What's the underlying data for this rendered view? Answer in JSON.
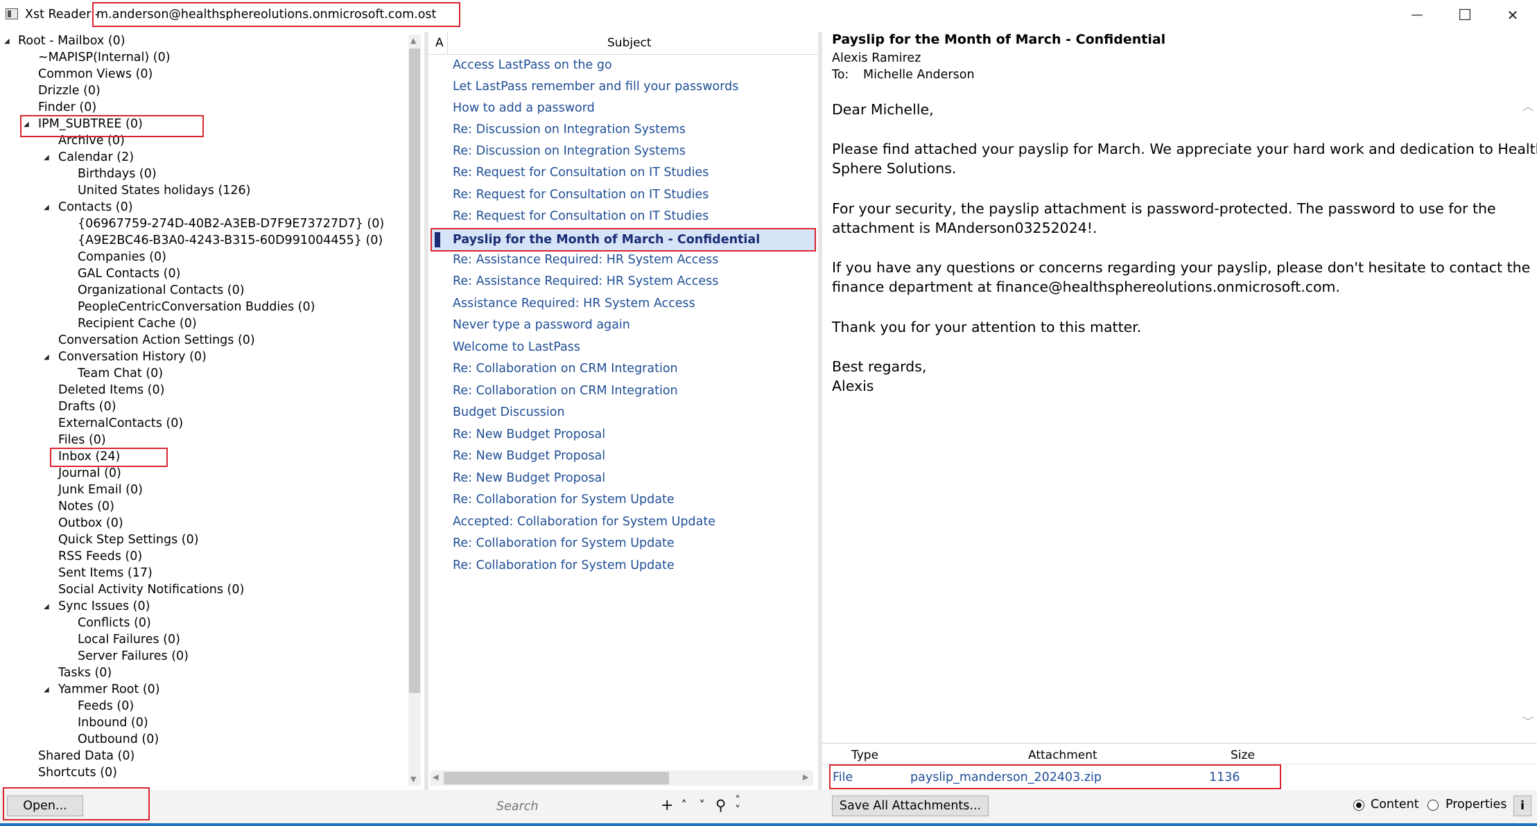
{
  "window": {
    "app_name": "Xst Reader - ",
    "file_name": "m.anderson@healthsphereolutions.onmicrosoft.com.ost",
    "minimize_glyph": "—",
    "maximize_glyph": "☐",
    "close_glyph": "✕"
  },
  "tree": {
    "items": [
      {
        "label": "Root - Mailbox (0)"
      },
      {
        "label": "~MAPISP(Internal) (0)"
      },
      {
        "label": "Common Views (0)"
      },
      {
        "label": "Drizzle (0)"
      },
      {
        "label": "Finder (0)"
      },
      {
        "label": "IPM_SUBTREE (0)"
      },
      {
        "label": "Archive (0)"
      },
      {
        "label": "Calendar (2)"
      },
      {
        "label": "Birthdays (0)"
      },
      {
        "label": "United States holidays (126)"
      },
      {
        "label": "Contacts (0)"
      },
      {
        "label": "{06967759-274D-40B2-A3EB-D7F9E73727D7} (0)"
      },
      {
        "label": "{A9E2BC46-B3A0-4243-B315-60D991004455} (0)"
      },
      {
        "label": "Companies (0)"
      },
      {
        "label": "GAL Contacts (0)"
      },
      {
        "label": "Organizational Contacts (0)"
      },
      {
        "label": "PeopleCentricConversation Buddies (0)"
      },
      {
        "label": "Recipient Cache (0)"
      },
      {
        "label": "Conversation Action Settings (0)"
      },
      {
        "label": "Conversation History (0)"
      },
      {
        "label": "Team Chat (0)"
      },
      {
        "label": "Deleted Items (0)"
      },
      {
        "label": "Drafts (0)"
      },
      {
        "label": "ExternalContacts (0)"
      },
      {
        "label": "Files (0)"
      },
      {
        "label": "Inbox (24)"
      },
      {
        "label": "Journal (0)"
      },
      {
        "label": "Junk Email (0)"
      },
      {
        "label": "Notes (0)"
      },
      {
        "label": "Outbox (0)"
      },
      {
        "label": "Quick Step Settings (0)"
      },
      {
        "label": "RSS Feeds (0)"
      },
      {
        "label": "Sent Items (17)"
      },
      {
        "label": "Social Activity Notifications (0)"
      },
      {
        "label": "Sync Issues (0)"
      },
      {
        "label": "Conflicts (0)"
      },
      {
        "label": "Local Failures (0)"
      },
      {
        "label": "Server Failures (0)"
      },
      {
        "label": "Tasks (0)"
      },
      {
        "label": "Yammer Root (0)"
      },
      {
        "label": "Feeds (0)"
      },
      {
        "label": "Inbound (0)"
      },
      {
        "label": "Outbound (0)"
      },
      {
        "label": "Shared Data (0)"
      },
      {
        "label": "Shortcuts (0)"
      }
    ]
  },
  "list": {
    "col_attachment": "A",
    "col_subject": "Subject",
    "rows": [
      {
        "subject": "Access LastPass on the go"
      },
      {
        "subject": "Let LastPass remember and fill your passwords"
      },
      {
        "subject": "How to add a password"
      },
      {
        "subject": "Re: Discussion on Integration Systems"
      },
      {
        "subject": "Re: Discussion on Integration Systems"
      },
      {
        "subject": "Re: Request for Consultation on IT Studies"
      },
      {
        "subject": "Re: Request for Consultation on IT Studies"
      },
      {
        "subject": "Re: Request for Consultation on IT Studies"
      },
      {
        "subject": "Payslip for the Month of March - Confidential"
      },
      {
        "subject": "Re: Assistance Required: HR System Access"
      },
      {
        "subject": "Re: Assistance Required: HR System Access"
      },
      {
        "subject": "Assistance Required: HR System Access"
      },
      {
        "subject": "Never type a password again"
      },
      {
        "subject": "Welcome to LastPass"
      },
      {
        "subject": "Re: Collaboration on CRM Integration"
      },
      {
        "subject": "Re: Collaboration on CRM Integration"
      },
      {
        "subject": "Budget Discussion"
      },
      {
        "subject": "Re: New Budget Proposal"
      },
      {
        "subject": "Re: New Budget Proposal"
      },
      {
        "subject": "Re: New Budget Proposal"
      },
      {
        "subject": "Re: Collaboration for System Update"
      },
      {
        "subject": "Accepted: Collaboration for System Update"
      },
      {
        "subject": "Re: Collaboration for System Update"
      },
      {
        "subject": "Re: Collaboration for System Update"
      }
    ]
  },
  "email": {
    "subject": "Payslip for the Month of March - Confidential",
    "from": "Alexis Ramirez",
    "to_label": "To:",
    "to": "Michelle Anderson",
    "body_lines": [
      "Dear Michelle,",
      "Please find attached your payslip for March. We appreciate your hard work and dedication to Health",
      "Sphere Solutions.",
      "For your security, the payslip attachment is password-protected. The password to use for the",
      "attachment is MAnderson03252024!.",
      "If you have any questions or concerns regarding your payslip, please don't hesitate to contact the",
      "finance department at finance@healthsphereolutions.onmicrosoft.com.",
      "Thank you for your attention to this matter.",
      "Best regards,",
      "Alexis"
    ]
  },
  "attachments": {
    "col_type": "Type",
    "col_name": "Attachment",
    "col_size": "Size",
    "rows": [
      {
        "type": "File",
        "name": "payslip_manderson_202403.zip",
        "size": "1136"
      }
    ]
  },
  "bottom": {
    "open_label": "Open...",
    "search_placeholder": "Search",
    "save_all_label": "Save All Attachments...",
    "content_label": "Content",
    "properties_label": "Properties",
    "info_label": "i"
  },
  "colors": {
    "highlight_red": "#d9242f",
    "link_blue": "#1f4e96",
    "selection": "#d5e4f7"
  }
}
